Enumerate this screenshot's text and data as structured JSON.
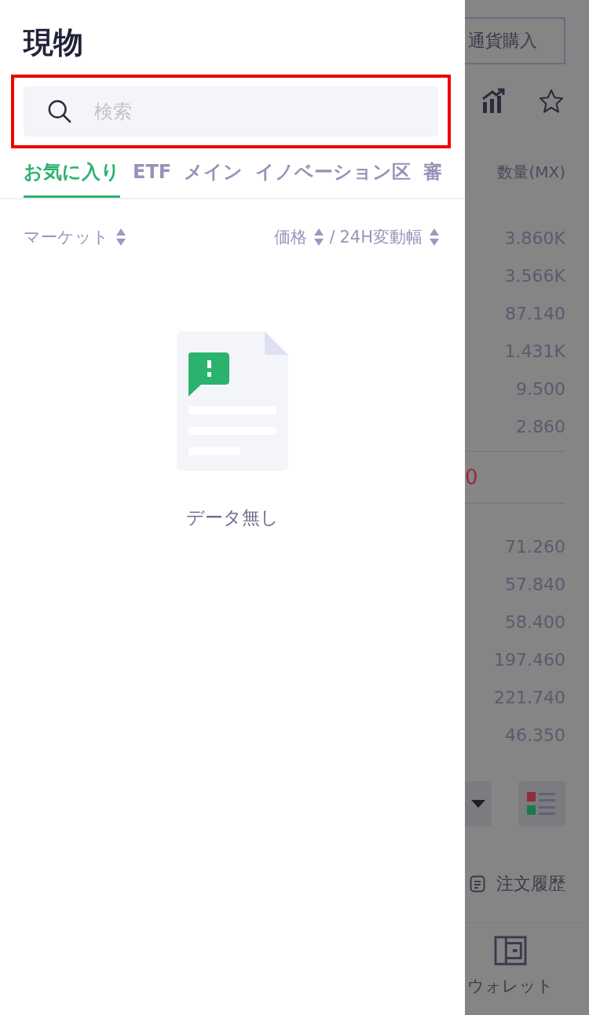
{
  "drawer": {
    "title": "現物",
    "search": {
      "placeholder": "検索",
      "highlighted": true
    },
    "tabs": [
      {
        "label": "お気に入り",
        "selected": true
      },
      {
        "label": "ETF",
        "selected": false
      },
      {
        "label": "メイン",
        "selected": false
      },
      {
        "label": "イノベーション区",
        "selected": false
      },
      {
        "label": "審",
        "selected": false
      }
    ],
    "sort_header": {
      "market": "マーケット",
      "price": "価格",
      "separator": "/",
      "change": "24H変動幅"
    },
    "empty_state": {
      "message": "データ無し"
    }
  },
  "background": {
    "buy_button": "通貨購入",
    "quantity_header": "数量(MX)",
    "asks": [
      "3.860K",
      "3.566K",
      "87.140",
      "1.431K",
      "9.500",
      "2.860"
    ],
    "last_price": "0",
    "bids": [
      "71.260",
      "57.840",
      "58.400",
      "197.460",
      "221.740",
      "46.350"
    ],
    "order_history": "注文履歴",
    "nav_item": "ウォレット"
  }
}
